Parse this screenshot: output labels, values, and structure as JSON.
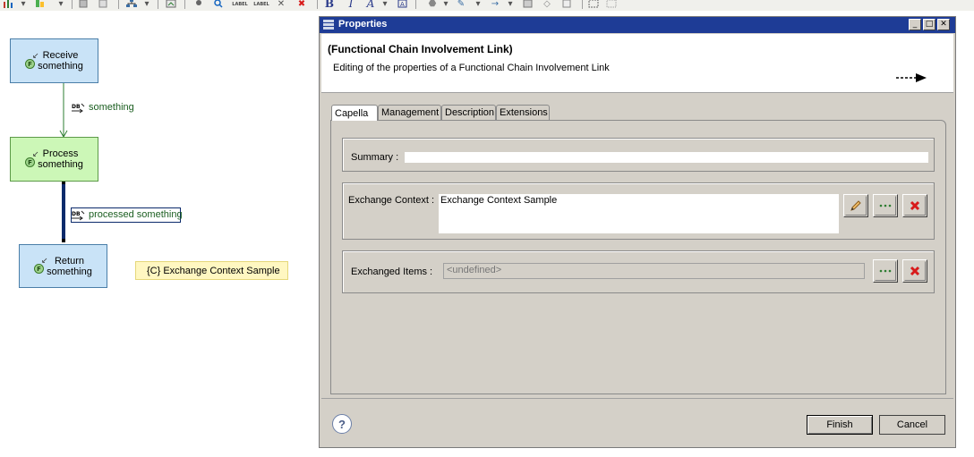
{
  "toolbar": {
    "label_1": "LABEL",
    "label_2": "LABEL",
    "bold": "B",
    "italic": "I",
    "font_color": "A"
  },
  "diagram": {
    "functions": [
      {
        "badge": "F",
        "name": "Receive\nsomething",
        "color": "#c9e3f7"
      },
      {
        "badge": "F",
        "name": "Process\nsomething",
        "color": "#ccf7b7"
      },
      {
        "badge": "F",
        "name": "Return\nsomething",
        "color": "#c9e3f7"
      }
    ],
    "exchanges": [
      {
        "label": "something"
      },
      {
        "label": "processed something"
      }
    ],
    "exchange_icon": "DB",
    "context_note": "{C} Exchange Context Sample"
  },
  "dialog": {
    "title": "Properties",
    "header_title": "(Functional Chain Involvement Link)",
    "header_subtitle": "Editing of the properties of a Functional Chain Involvement Link",
    "tabs": [
      {
        "label": "Capella",
        "active": true
      },
      {
        "label": "Management",
        "active": false
      },
      {
        "label": "Description",
        "active": false
      },
      {
        "label": "Extensions",
        "active": false
      }
    ],
    "fields": {
      "summary_label": "Summary :",
      "summary_value": "",
      "exchange_context_label": "Exchange Context :",
      "exchange_context_value": "Exchange Context Sample",
      "exchanged_items_label": "Exchanged Items :",
      "exchanged_items_value": "<undefined>"
    },
    "help": "?",
    "finish": "Finish",
    "cancel": "Cancel"
  },
  "colors": {
    "titlebar": "#1e3c96",
    "function_blue": "#c9e3f7",
    "function_green": "#ccf7b7",
    "context_note_bg": "#fff7c1",
    "delete_red": "#d81b1b"
  },
  "icons": [
    "bold-icon",
    "italic-icon",
    "font-color-icon",
    "pencil-icon",
    "ellipsis-icon",
    "delete-icon",
    "help-icon",
    "dashed-arrow-icon",
    "minimize-icon",
    "maximize-icon",
    "close-icon",
    "properties-icon"
  ]
}
